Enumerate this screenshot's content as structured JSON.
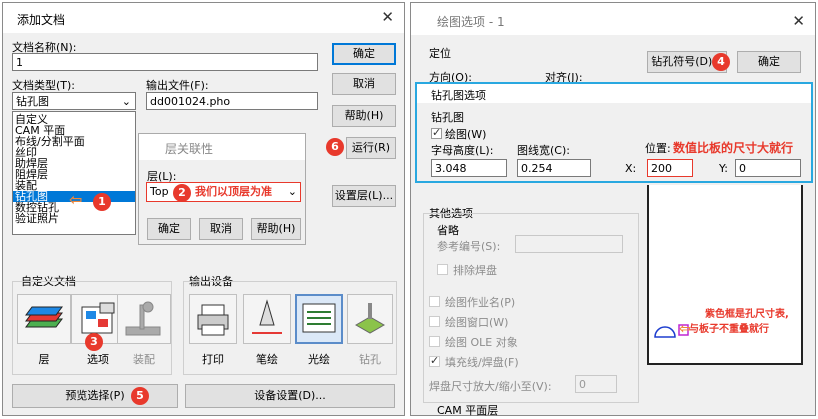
{
  "add_dialog": {
    "title": "添加文档",
    "doc_name_label": "文档名称(N):",
    "doc_name_value": "1",
    "doc_type_label": "文档类型(T):",
    "doc_type_value": "钻孔图",
    "output_file_label": "输出文件(F):",
    "output_file_value": "dd001024.pho",
    "type_options": [
      "自定义",
      "CAM 平面",
      "布线/分割平面",
      "丝印",
      "助焊层",
      "阻焊层",
      "装配",
      "钻孔图",
      "数控钻孔",
      "验证照片"
    ],
    "ok": "确定",
    "cancel": "取消",
    "help": "帮助(H)",
    "run": "运行(R)",
    "layer_settings": "设置层(L)...",
    "custom_doc": "自定义文档",
    "output_device": "输出设备",
    "custom_buttons": [
      "层",
      "选项",
      "装配"
    ],
    "device_buttons": [
      "打印",
      "笔绘",
      "光绘",
      "钻孔"
    ],
    "preview": "预览选择(P)",
    "device_settings": "设备设置(D)..."
  },
  "layer_dialog": {
    "title": "层关联性",
    "layer_label": "层(L):",
    "layer_value": "Top",
    "annotation": "我们以顶层为准",
    "ok": "确定",
    "cancel": "取消",
    "help": "帮助(H)"
  },
  "badges": [
    "1",
    "2",
    "3",
    "4",
    "5",
    "6"
  ],
  "draw_dialog": {
    "title": "绘图选项 - 1",
    "position": "定位",
    "direction": "方向(O):",
    "align": "对齐(J):",
    "drill_symbol": "钻孔符号(D)...",
    "ok": "确定",
    "drill_options_title": "钻孔图选项",
    "drill_map": "钻孔图",
    "draw_chk": "绘图(W)",
    "char_height_label": "字母高度(L):",
    "char_height_value": "3.048",
    "line_width_label": "图线宽(C):",
    "line_width_value": "0.254",
    "position_label": "位置:",
    "position_note": "数值比板的尺寸大就行",
    "x_label": "X:",
    "x_value": "200",
    "y_label": "Y:",
    "y_value": "0",
    "other_options": "其他选项",
    "omit": "省略",
    "ref_label": "参考编号(S):",
    "exclude_pad": "排除焊盘",
    "opts": [
      "绘图作业名(P)",
      "绘图窗口(W)",
      "绘图 OLE 对象",
      "填充线/焊盘(F)"
    ],
    "pad_scale_label": "焊盘尺寸放大/缩小至(V):",
    "pad_scale_value": "0",
    "cam_plane": "CAM 平面层",
    "preview_note_1": "紫色框是孔尺寸表,",
    "preview_note_2": "与板子不重叠就行"
  }
}
